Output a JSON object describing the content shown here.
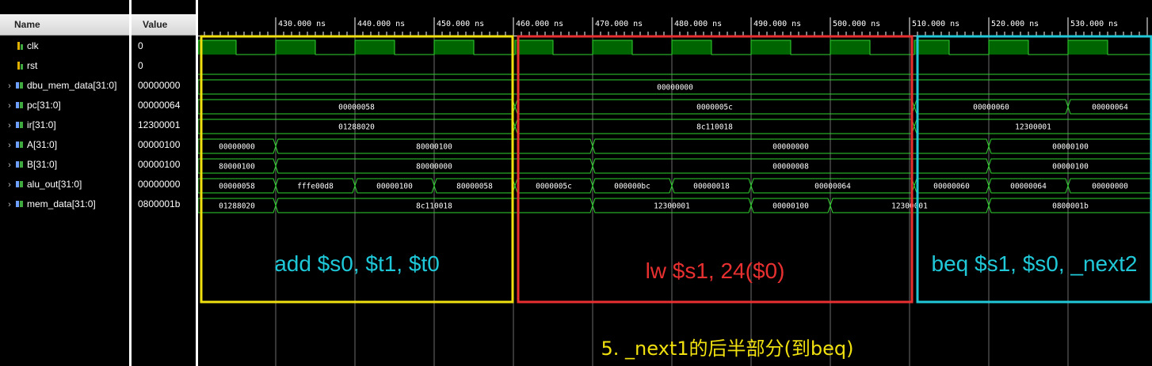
{
  "panel": {
    "name_header": "Name",
    "value_header": "Value"
  },
  "signals": [
    {
      "name": "clk",
      "value": "0",
      "kind": "bit",
      "expandable": false
    },
    {
      "name": "rst",
      "value": "0",
      "kind": "bit",
      "expandable": false
    },
    {
      "name": "dbu_mem_data[31:0]",
      "value": "00000000",
      "kind": "bus",
      "expandable": true
    },
    {
      "name": "pc[31:0]",
      "value": "00000064",
      "kind": "bus",
      "expandable": true
    },
    {
      "name": "ir[31:0]",
      "value": "12300001",
      "kind": "bus",
      "expandable": true
    },
    {
      "name": "A[31:0]",
      "value": "00000100",
      "kind": "bus",
      "expandable": true
    },
    {
      "name": "B[31:0]",
      "value": "00000100",
      "kind": "bus",
      "expandable": true
    },
    {
      "name": "alu_out[31:0]",
      "value": "00000000",
      "kind": "bus",
      "expandable": true
    },
    {
      "name": "mem_data[31:0]",
      "value": "0800001b",
      "kind": "bus",
      "expandable": true
    }
  ],
  "time_axis": {
    "ticks_ns": [
      430,
      440,
      450,
      460,
      470,
      480,
      490,
      500,
      510,
      520,
      530
    ],
    "tick_labels": [
      "430.000 ns",
      "440.000 ns",
      "450.000 ns",
      "460.000 ns",
      "470.000 ns",
      "480.000 ns",
      "490.000 ns",
      "500.000 ns",
      "510.000 ns",
      "520.000 ns",
      "530.000 ns"
    ],
    "view_start_ns": 420.2,
    "view_end_ns": 540.6
  },
  "clk_high_ranges_ns": [
    [
      420.2,
      425
    ],
    [
      430,
      435
    ],
    [
      440,
      445
    ],
    [
      450,
      455
    ],
    [
      460.2,
      465
    ],
    [
      470,
      475
    ],
    [
      480,
      485
    ],
    [
      490,
      495
    ],
    [
      500,
      505
    ],
    [
      510.6,
      515
    ],
    [
      520,
      525
    ],
    [
      530,
      535
    ]
  ],
  "waves": {
    "dbu_mem_data[31:0]": [
      {
        "from": 420.2,
        "to": 540.6,
        "label": "00000000"
      }
    ],
    "pc[31:0]": [
      {
        "from": 420.2,
        "to": 460.2,
        "label": "00000058"
      },
      {
        "from": 460.2,
        "to": 510.6,
        "label": "0000005c"
      },
      {
        "from": 510.6,
        "to": 530,
        "label": "00000060"
      },
      {
        "from": 530,
        "to": 540.6,
        "label": "00000064"
      }
    ],
    "ir[31:0]": [
      {
        "from": 420.2,
        "to": 460.2,
        "label": "01288020"
      },
      {
        "from": 460.2,
        "to": 510.6,
        "label": "8c110018"
      },
      {
        "from": 510.6,
        "to": 540.6,
        "label": "12300001"
      }
    ],
    "A[31:0]": [
      {
        "from": 420.2,
        "to": 430,
        "label": "00000000"
      },
      {
        "from": 430,
        "to": 470,
        "label": "80000100"
      },
      {
        "from": 470,
        "to": 520,
        "label": "00000000"
      },
      {
        "from": 520,
        "to": 540.6,
        "label": "00000100"
      }
    ],
    "B[31:0]": [
      {
        "from": 420.2,
        "to": 430,
        "label": "80000100"
      },
      {
        "from": 430,
        "to": 470,
        "label": "80000000"
      },
      {
        "from": 470,
        "to": 520,
        "label": "00000008"
      },
      {
        "from": 520,
        "to": 540.6,
        "label": "00000100"
      }
    ],
    "alu_out[31:0]": [
      {
        "from": 420.2,
        "to": 430,
        "label": "00000058"
      },
      {
        "from": 430,
        "to": 440,
        "label": "fffe00d8"
      },
      {
        "from": 440,
        "to": 450,
        "label": "00000100"
      },
      {
        "from": 450,
        "to": 460.2,
        "label": "80000058"
      },
      {
        "from": 460.2,
        "to": 470,
        "label": "0000005c"
      },
      {
        "from": 470,
        "to": 480,
        "label": "000000bc"
      },
      {
        "from": 480,
        "to": 490,
        "label": "00000018"
      },
      {
        "from": 490,
        "to": 510.6,
        "label": "00000064"
      },
      {
        "from": 510.6,
        "to": 520,
        "label": "00000060"
      },
      {
        "from": 520,
        "to": 530,
        "label": "00000064"
      },
      {
        "from": 530,
        "to": 540.6,
        "label": "00000000"
      }
    ],
    "mem_data[31:0]": [
      {
        "from": 420.2,
        "to": 430,
        "label": "01288020"
      },
      {
        "from": 430,
        "to": 470,
        "label": "8c110018"
      },
      {
        "from": 470,
        "to": 490,
        "label": "12300001"
      },
      {
        "from": 490,
        "to": 500,
        "label": "00000100"
      },
      {
        "from": 500,
        "to": 520,
        "label": "12300001"
      },
      {
        "from": 520,
        "to": 540.6,
        "label": "0800001b"
      }
    ]
  },
  "annotations": {
    "boxes": [
      {
        "label": "add $s0, $t1, $t0",
        "from": 420.2,
        "to": 460,
        "color": "#f0e010",
        "text_color": "#1ec8d8"
      },
      {
        "label": "lw $s1, 24($0)",
        "from": 460.2,
        "to": 510.4,
        "color": "#e83030",
        "text_color": "#e83030"
      },
      {
        "label": "beq $s1, $s0, _next2",
        "from": 510.6,
        "to": 540.6,
        "color": "#20c8d8",
        "text_color": "#20c8d8"
      }
    ],
    "caption": "5. _next1的后半部分(到beq)",
    "caption_color": "#f0e010"
  },
  "colors": {
    "wave": "#2fd22f",
    "clk_fill": "#006400",
    "grid": "#8a8a8a",
    "text": "#ffffff"
  }
}
